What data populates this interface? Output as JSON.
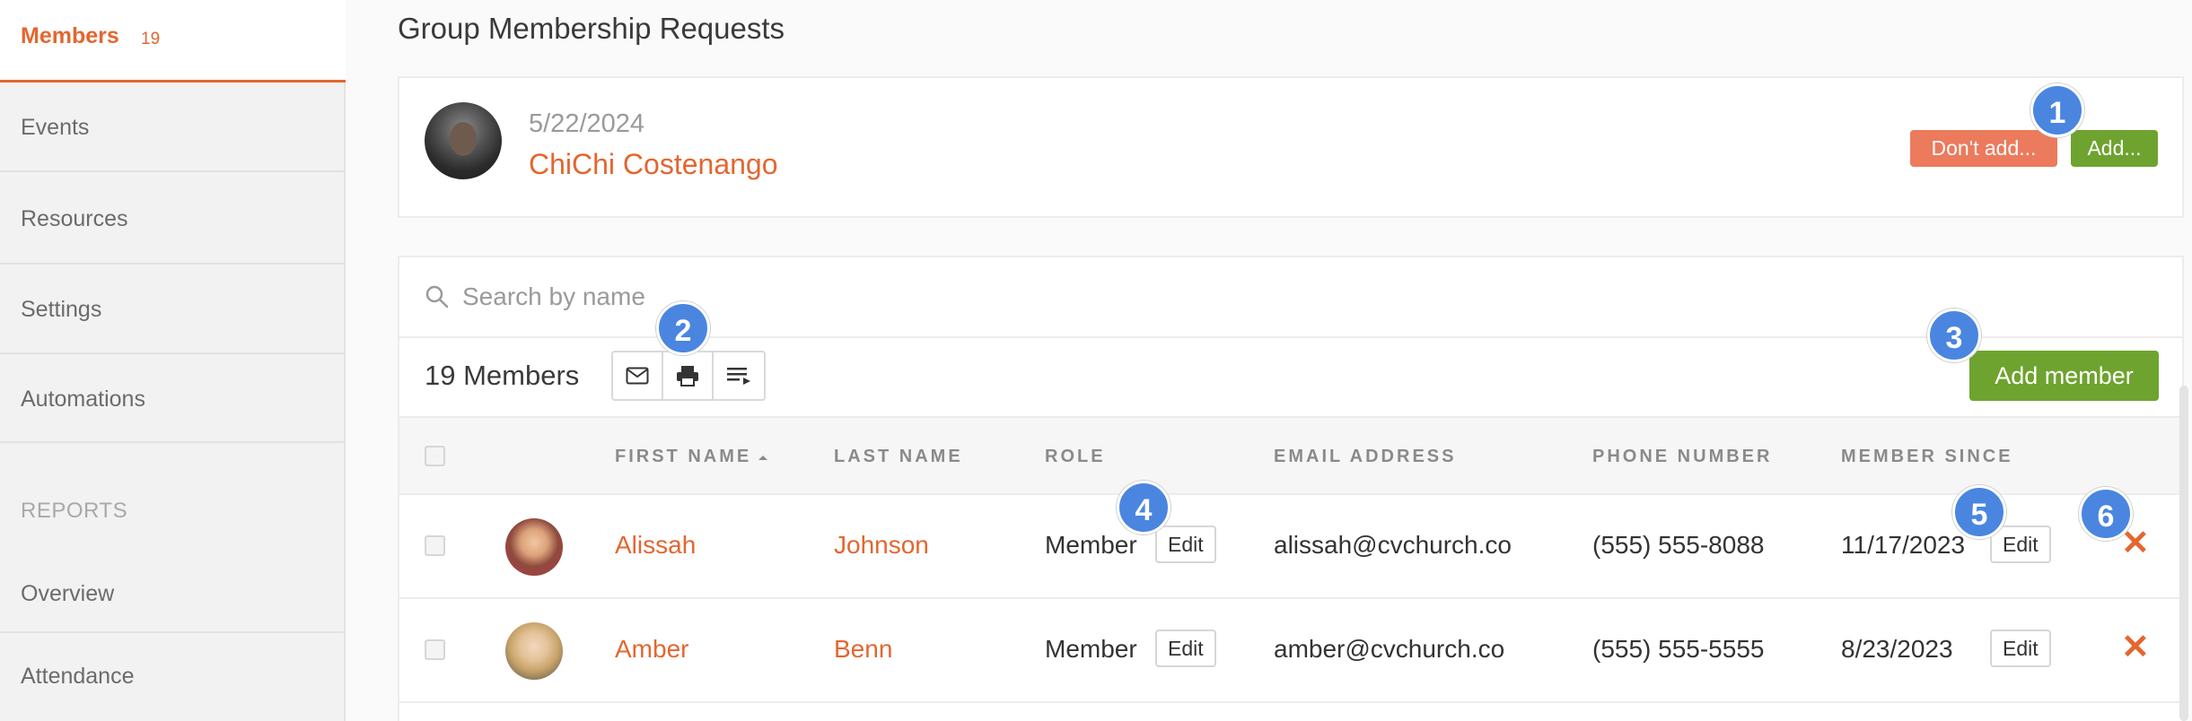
{
  "sidebar": {
    "active": {
      "label": "Members",
      "count": "19"
    },
    "items": [
      {
        "label": "Events"
      },
      {
        "label": "Resources"
      },
      {
        "label": "Settings"
      },
      {
        "label": "Automations"
      }
    ],
    "reports_heading": "REPORTS",
    "report_items": [
      {
        "label": "Overview"
      },
      {
        "label": "Attendance"
      }
    ]
  },
  "page": {
    "title": "Group Membership Requests"
  },
  "request": {
    "date": "5/22/2024",
    "name": "ChiChi Costenango",
    "dont_add_label": "Don't add...",
    "add_label": "Add..."
  },
  "members": {
    "search_placeholder": "Search by name",
    "count_label": "19 Members",
    "add_member_label": "Add member",
    "columns": {
      "first_name": "FIRST NAME",
      "last_name": "LAST NAME",
      "role": "ROLE",
      "email": "EMAIL ADDRESS",
      "phone": "PHONE NUMBER",
      "member_since": "MEMBER SINCE"
    },
    "rows": [
      {
        "first": "Alissah",
        "last": "Johnson",
        "role": "Member",
        "edit": "Edit",
        "email": "alissah@cvchurch.co",
        "phone": "(555) 555-8088",
        "since": "11/17/2023",
        "since_edit": "Edit"
      },
      {
        "first": "Amber",
        "last": "Benn",
        "role": "Member",
        "edit": "Edit",
        "email": "amber@cvchurch.co",
        "phone": "(555) 555-5555",
        "since": "8/23/2023",
        "since_edit": "Edit"
      }
    ]
  },
  "markers": [
    "1",
    "2",
    "3",
    "4",
    "5",
    "6"
  ],
  "icons": {
    "search": "search-icon",
    "email": "mail-icon",
    "print": "printer-icon",
    "sort": "sort-list-icon",
    "sort_arrow": "sort-ascending-icon",
    "delete": "close-x-icon"
  },
  "colors": {
    "accent": "#e4662f",
    "primary_green": "#6ea32f",
    "danger_salmon": "#ec7a5c",
    "marker_blue": "#4a86e0"
  }
}
